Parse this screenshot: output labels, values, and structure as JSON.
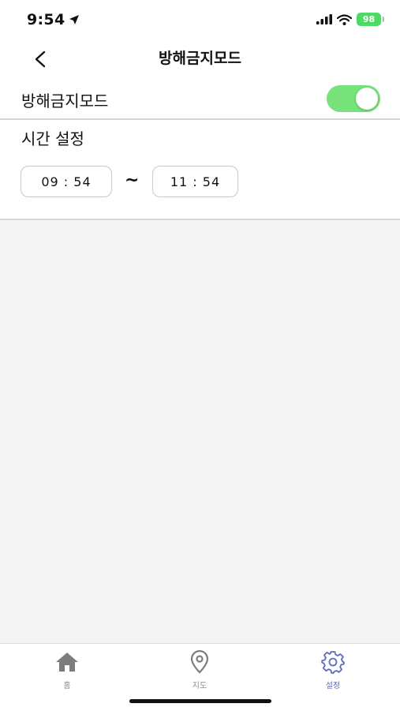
{
  "status_bar": {
    "time": "9:54",
    "battery": "98"
  },
  "header": {
    "title": "방해금지모드"
  },
  "dnd": {
    "label": "방해금지모드",
    "enabled": true
  },
  "time_setting": {
    "title": "시간 설정",
    "start": "09 : 54",
    "separator": "~",
    "end": "11 : 54"
  },
  "tabbar": {
    "items": [
      {
        "label": "홈",
        "icon": "home-icon"
      },
      {
        "label": "지도",
        "icon": "map-pin-icon"
      },
      {
        "label": "설정",
        "icon": "gear-icon"
      }
    ]
  },
  "colors": {
    "toggle_on": "#78e37b",
    "active_tab": "#5b6bbf",
    "battery": "#4cd964"
  }
}
